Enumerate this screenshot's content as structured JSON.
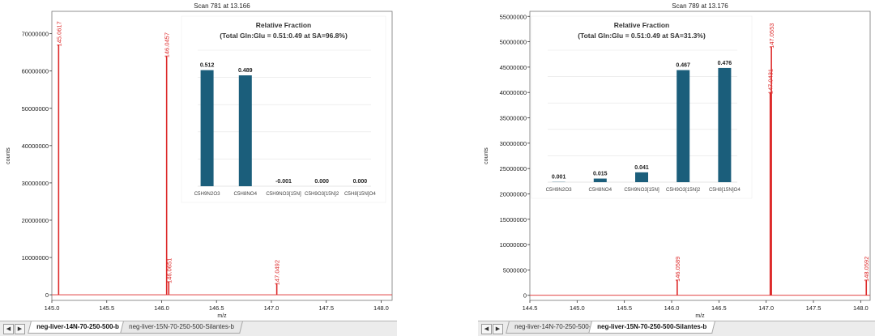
{
  "colors": {
    "spectrum": "#dd2a2a",
    "bar": "#1b5e7b",
    "axis": "#333333",
    "grid": "#e4e4e4"
  },
  "tabs": [
    "neg-liver-14N-70-250-500-b",
    "neg-liver-15N-70-250-500-Silantes-b"
  ],
  "nav": {
    "prev": "◀",
    "next": "▶"
  },
  "panels": [
    {
      "active_tab": 0,
      "chart_data": {
        "type": "line",
        "title": "Scan 781 at 13.166",
        "xlabel": "m/z",
        "ylabel": "counts",
        "xlim": [
          145.0,
          148.1
        ],
        "ylim": [
          -1500000,
          76000000
        ],
        "xticks": [
          145.0,
          145.5,
          146.0,
          146.5,
          147.0,
          147.5,
          148.0
        ],
        "xtick_labels": [
          "145.0",
          "145.5",
          "146.0",
          "146.5",
          "147.0",
          "147.5",
          "148.0"
        ],
        "yticks": [
          0,
          10000000,
          20000000,
          30000000,
          40000000,
          50000000,
          60000000,
          70000000
        ],
        "ytick_labels": [
          "0",
          "10000000",
          "20000000",
          "30000000",
          "40000000",
          "50000000",
          "60000000",
          "70000000"
        ],
        "peaks": [
          {
            "mz": 145.0617,
            "intensity": 67000000,
            "label": "145.0617"
          },
          {
            "mz": 146.0457,
            "intensity": 64000000,
            "label": "146.0457"
          },
          {
            "mz": 146.0651,
            "intensity": 3500000,
            "label": "146.0651"
          },
          {
            "mz": 147.0492,
            "intensity": 3000000,
            "label": "147.0492"
          }
        ]
      },
      "inset": {
        "type": "bar",
        "title": "Relative Fraction",
        "subtitle": "(Total Gln:Glu = 0.51:0.49 at SA=96.8%)",
        "categories": [
          "C5H9N2O3",
          "C5H8NO4",
          "C5H9NO3[15N]",
          "C5H9O3[15N]2",
          "C5H8[15N]O4"
        ],
        "values": [
          0.512,
          0.489,
          -0.001,
          0.0,
          0.0
        ],
        "value_labels": [
          "0.512",
          "0.489",
          "-0.001",
          "0.000",
          "0.000"
        ],
        "ylim": [
          0,
          0.6
        ]
      }
    },
    {
      "active_tab": 1,
      "chart_data": {
        "type": "line",
        "title": "Scan 789 at 13.176",
        "xlabel": "m/z",
        "ylabel": "counts",
        "xlim": [
          144.5,
          148.1
        ],
        "ylim": [
          -1000000,
          56000000
        ],
        "xticks": [
          144.5,
          145.0,
          145.5,
          146.0,
          146.5,
          147.0,
          147.5,
          148.0
        ],
        "xtick_labels": [
          "144.5",
          "145.0",
          "145.5",
          "146.0",
          "146.5",
          "147.0",
          "147.5",
          "148.0"
        ],
        "yticks": [
          0,
          5000000,
          10000000,
          15000000,
          20000000,
          25000000,
          30000000,
          35000000,
          40000000,
          45000000,
          50000000,
          55000000
        ],
        "ytick_labels": [
          "0",
          "5000000",
          "10000000",
          "15000000",
          "20000000",
          "25000000",
          "30000000",
          "35000000",
          "40000000",
          "45000000",
          "50000000",
          "55000000"
        ],
        "peaks": [
          {
            "mz": 146.0589,
            "intensity": 3000000,
            "label": "146.0589"
          },
          {
            "mz": 147.0431,
            "intensity": 40000000,
            "label": "147.0431"
          },
          {
            "mz": 147.0553,
            "intensity": 49000000,
            "label": "147.0553"
          },
          {
            "mz": 148.0592,
            "intensity": 3000000,
            "label": "148.0592"
          }
        ]
      },
      "inset": {
        "type": "bar",
        "title": "Relative Fraction",
        "subtitle": "(Total Gln:Glu = 0.51:0.49 at SA=31.3%)",
        "categories": [
          "C5H9N2O3",
          "C5H8NO4",
          "C5H9NO3[15N]",
          "C5H9O3[15N]2",
          "C5H8[15N]O4"
        ],
        "values": [
          0.001,
          0.015,
          0.041,
          0.467,
          0.476
        ],
        "value_labels": [
          "0.001",
          "0.015",
          "0.041",
          "0.467",
          "0.476"
        ],
        "ylim": [
          0,
          0.55
        ]
      }
    }
  ]
}
